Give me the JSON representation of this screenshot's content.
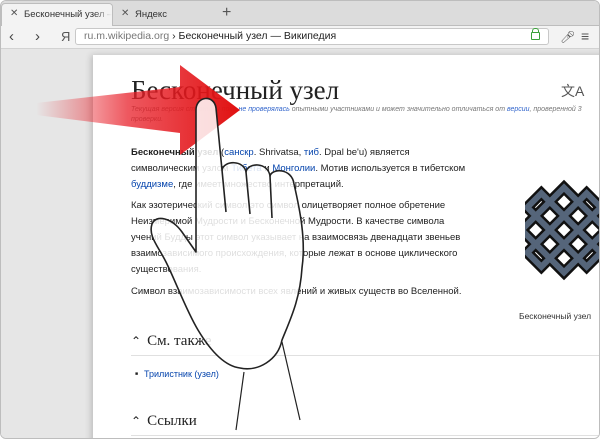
{
  "tabs": [
    {
      "label": "Бесконечный узел —",
      "active": true
    },
    {
      "label": "Яндекс",
      "active": false
    }
  ],
  "toolbar": {
    "yandex_logo": "Я",
    "address_host": "ru.m.wikipedia.org",
    "address_sep": " › ",
    "address_page": "Бесконечный узел — Википедия"
  },
  "article": {
    "title": "Бесконечный узел",
    "note_prefix": "Текущая версия ",
    "note_hidden": "страницы пока",
    "note_link": "не проверялась",
    "note_mid": " опытными участниками и может значительно отличаться от ",
    "note_link2": "версии",
    "note_suffix": ", проверенной 3",
    "note_line2": "проверки.",
    "p1_bold": "Бесконечный узел",
    "p1_a": " (",
    "p1_link1": "санскр",
    "p1_b": ". Shrivatsa, ",
    "p1_link2": "тиб",
    "p1_c": ". Dpal be'u) является",
    "p1_line2_a": "символическим узлом ",
    "p1_link3": "Тибета",
    "p1_line2_b": " и ",
    "p1_link4": "Монголии",
    "p1_line2_c": ". Мотив используется в тибетском",
    "p1_link5": "буддизме",
    "p1_line3": ", где имеет множество интерпретаций.",
    "p2_line1": "Как эзотерический символ это символ олицетворяет полное обретение",
    "p2_line2": "Неизмеримой Мудрости и Бесконечной Мудрости. В качестве символа",
    "p2_line3": "учений Будды этот символ указывает на взаимосвязь двенадцати звеньев",
    "p2_line4": "взаимозависимого происхождения, которые лежат в основе циклического",
    "p2_line5": "существования.",
    "p3": "Символ взаимозависимости всех явлений и живых существ во Вселенной.",
    "caption": "Бесконечный узел",
    "section1": "См. также",
    "list_item": "Трилистник (узел)",
    "section2": "Ссылки"
  },
  "icons": [
    "close-icon",
    "plus-icon",
    "back-icon",
    "forward-icon",
    "lock-icon",
    "microphone-icon",
    "menu-icon",
    "translate-icon",
    "chevron-up-icon"
  ],
  "colors": {
    "arrow": "#e8202a",
    "link": "#0645ad",
    "knot": "#55657a"
  }
}
